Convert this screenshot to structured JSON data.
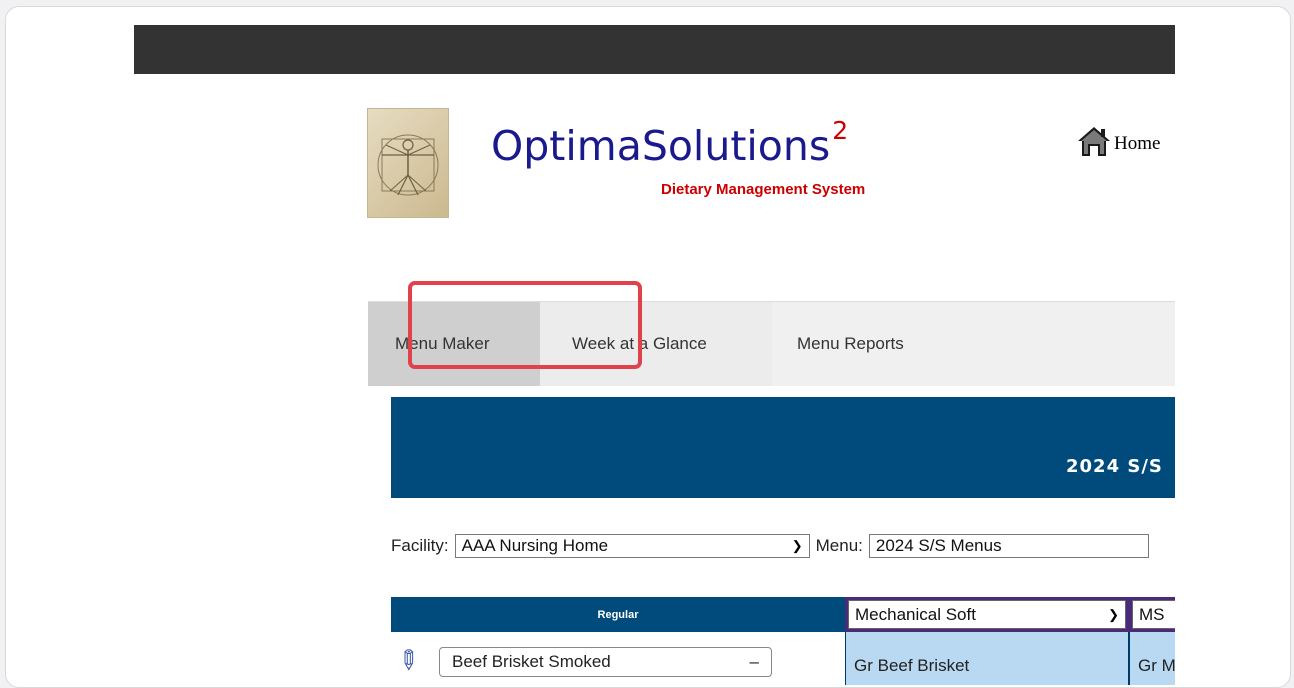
{
  "brand": {
    "name": "OptimaSolutions",
    "superscript": "2",
    "tagline": "Dietary Management System"
  },
  "header": {
    "home_label": "Home"
  },
  "nav": {
    "tabs": [
      {
        "label": "Menu Maker"
      },
      {
        "label": "Week at a Glance",
        "highlighted": true
      },
      {
        "label": "Menu Reports"
      }
    ]
  },
  "banner": {
    "title": "2024 S/S"
  },
  "filters": {
    "facility_label": "Facility:",
    "facility_value": "AAA Nursing Home",
    "menu_label": "Menu:",
    "menu_value": "2024 S/S Menus"
  },
  "grid": {
    "columns": [
      {
        "label": "Regular"
      },
      {
        "label": "Mechanical Soft"
      },
      {
        "label": "MS"
      }
    ],
    "rows": [
      {
        "regular": "Beef Brisket Smoked",
        "mechanical_soft": "Gr Beef Brisket",
        "ms": "Gr M"
      }
    ]
  },
  "colors": {
    "brand_blue": "#1a1a8c",
    "brand_red": "#cc0000",
    "banner": "#004b7c",
    "highlight": "#e0424c",
    "cell_blue": "#b9d9f2"
  }
}
